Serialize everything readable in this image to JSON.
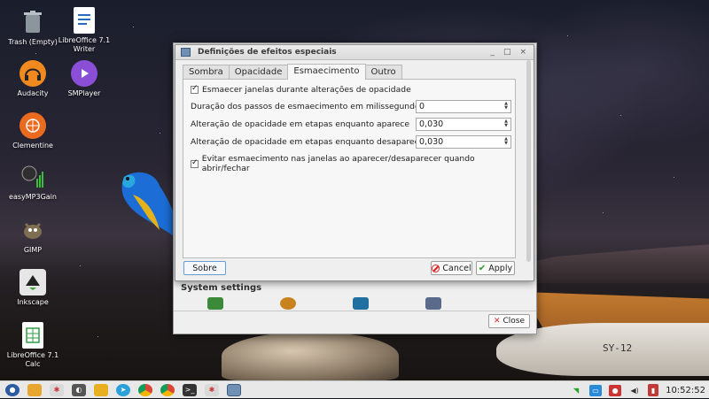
{
  "desktop": {
    "icons": [
      {
        "label": "Trash (Empty)",
        "icon": "trash-icon",
        "color": "#5f6b73"
      },
      {
        "label": "LibreOffice 7.1 Writer",
        "icon": "writer-icon",
        "color": "#2b6bbf"
      },
      {
        "label": "Audacity",
        "icon": "audacity-icon",
        "color": "#f07c1c"
      },
      {
        "label": "SMPlayer",
        "icon": "smplayer-icon",
        "color": "#8a4fd6"
      },
      {
        "label": "Clementine",
        "icon": "clementine-icon",
        "color": "#e7621d"
      },
      {
        "label": "easyMP3Gain",
        "icon": "easymp3gain-icon",
        "color": "#3a3a3a"
      },
      {
        "label": "GIMP",
        "icon": "gimp-icon",
        "color": "#8a7a5a"
      },
      {
        "label": "Inkscape",
        "icon": "inkscape-icon",
        "color": "#dcdcdc"
      },
      {
        "label": "LibreOffice 7.1 Calc",
        "icon": "calc-icon",
        "color": "#2f9e43"
      }
    ]
  },
  "background_window": {
    "section_title": "System settings",
    "close_label": "Close"
  },
  "dialog": {
    "title": "Definições de efeitos especiais",
    "controls": [
      "_",
      "□",
      "×"
    ],
    "tabs": [
      {
        "label": "Sombra",
        "active": false
      },
      {
        "label": "Opacidade",
        "active": false
      },
      {
        "label": "Esmaecimento",
        "active": true
      },
      {
        "label": "Outro",
        "active": false
      }
    ],
    "fade_checkbox": {
      "label": "Esmaecer janelas durante alterações de opacidade",
      "checked": true
    },
    "fields": [
      {
        "label": "Duração dos passos de esmaecimento em milissegundos",
        "value": "0"
      },
      {
        "label": "Alteração de opacidade em etapas enquanto aparece",
        "value": "0,030"
      },
      {
        "label": "Alteração de opacidade em etapas enquanto desaparece",
        "value": "0,030"
      }
    ],
    "avoid_checkbox": {
      "label": "Evitar esmaecimento nas janelas ao aparecer/desaparecer quando abrir/fechar",
      "checked": true
    },
    "about_label": "Sobre",
    "cancel_label": "Cancel",
    "apply_label": "Apply"
  },
  "taskbar": {
    "clock": "10:52:52"
  },
  "wallpaper": {
    "boat_number": "SY-12"
  }
}
